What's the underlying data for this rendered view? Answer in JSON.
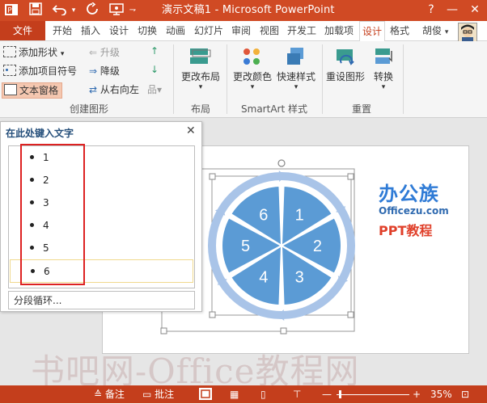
{
  "window": {
    "title": "演示文稿1 - Microsoft PowerPoint",
    "help": "?",
    "minimize": "—",
    "close": "✕"
  },
  "tabs": [
    {
      "label": "文件",
      "kind": "file"
    },
    {
      "label": "开始"
    },
    {
      "label": "插入"
    },
    {
      "label": "设计"
    },
    {
      "label": "切换"
    },
    {
      "label": "动画"
    },
    {
      "label": "幻灯片"
    },
    {
      "label": "审阅"
    },
    {
      "label": "视图"
    },
    {
      "label": "开发工"
    },
    {
      "label": "加载项"
    },
    {
      "label": "设计",
      "kind": "active"
    },
    {
      "label": "格式"
    }
  ],
  "user": {
    "name": "胡俊"
  },
  "ribbon": {
    "create_graphic": {
      "add_shape": "添加形状",
      "add_bullet": "添加项目符号",
      "text_pane": "文本窗格",
      "promote": "升级",
      "demote": "降级",
      "right_to_left": "从右向左",
      "label": "创建图形"
    },
    "layouts": {
      "change_layout": "更改布局",
      "label": "布局"
    },
    "smartart_styles": {
      "change_colors": "更改颜色",
      "quick_styles": "快速样式",
      "label": "SmartArt 样式"
    },
    "reset": {
      "reset_graphic": "重设图形",
      "convert": "转换",
      "label": "重置"
    }
  },
  "text_pane": {
    "title": "在此处键入文字",
    "close": "✕",
    "items": [
      "1",
      "2",
      "3",
      "4",
      "5",
      "6"
    ],
    "footer": "分段循环..."
  },
  "smartart": {
    "segments": [
      "1",
      "2",
      "3",
      "4",
      "5",
      "6"
    ],
    "fill_color": "#5b9bd5",
    "ring_color": "#a9c4e8"
  },
  "logo": {
    "brand": "办公族",
    "site": "Officezu.com",
    "tag": "PPT教程"
  },
  "status": {
    "notes": "备注",
    "comments": "批注",
    "zoom": "35%"
  },
  "watermark": "书吧网-Office教程网",
  "colors": {
    "accent": "#c43e1c",
    "title_bar": "#d04a24"
  }
}
